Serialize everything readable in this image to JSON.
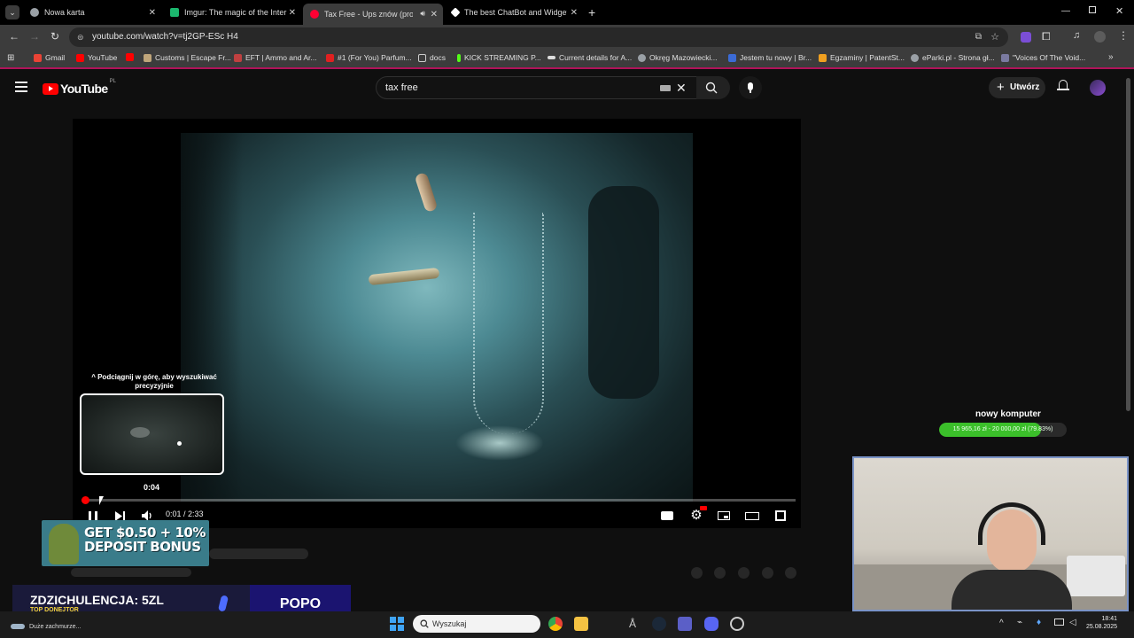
{
  "browser": {
    "tabs": [
      {
        "title": "Nowa karta",
        "favicon_color": "#9aa0a6"
      },
      {
        "title": "Imgur: The magic of the Interne",
        "favicon_color": "#1bb76e"
      },
      {
        "title": "Tax Free - Ups znów (prod.",
        "favicon_color": "#ff0033"
      },
      {
        "title": "The best ChatBot and Widgets",
        "favicon_color": "#ffffff"
      }
    ],
    "url": "youtube.com/watch?v=tj2GP-ESc H4",
    "bookmarks": [
      {
        "label": "Gmail",
        "color": "#ea4335"
      },
      {
        "label": "YouTube",
        "color": "#ff0000"
      },
      {
        "label": "Customs | Escape Fr...",
        "color": "#bfa57a"
      },
      {
        "label": "EFT | Ammo and Ar...",
        "color": "#c04040"
      },
      {
        "label": "#1 (For You) Parfum...",
        "color": "#e02020"
      },
      {
        "label": "docs",
        "color": "#9aa0a6"
      },
      {
        "label": "KICK STREAMING P...",
        "color": "#53fc18"
      },
      {
        "label": "Current details for A...",
        "color": "#dddddd"
      },
      {
        "label": "Okręg Mazowiecki...",
        "color": "#9aa0a6"
      },
      {
        "label": "Jestem tu nowy | Br...",
        "color": "#3b6bd6"
      },
      {
        "label": "Egzaminy | PatentSt...",
        "color": "#f0a020"
      },
      {
        "label": "eParki.pl - Strona gł...",
        "color": "#9aa0a6"
      },
      {
        "label": "\"Voices Of The Void...",
        "color": "#7a7aa0"
      }
    ]
  },
  "youtube": {
    "logo_text": "YouTube",
    "region": "PL",
    "search_value": "tax free",
    "create_label": "Utwórz"
  },
  "player": {
    "seek_hint": "Podciągnij w górę, aby wyszukiwać precyzyjnie",
    "preview_time": "0:04",
    "current_time": "0:01",
    "duration": "2:33",
    "time_display": "0:01 / 2:33",
    "progress_fraction": 0.0065
  },
  "overlay": {
    "goal_title": "nowy komputer",
    "goal_text": "15 965,16 zł - 20 000,00 zł (79.83%)",
    "goal_fraction": 0.7983,
    "goal_color": "#3bbf2a",
    "ad_text_line1": "GET $0.50 + 10%",
    "ad_text_line2": "DEPOSIT BONUS",
    "donor_name": "ZDZICHULENCJA: 5ZL",
    "donor_sub": "TOP DONEJTOR",
    "popo": "POPO"
  },
  "taskbar": {
    "search_placeholder": "Wyszukaj",
    "weather": "Duże zachmurze...",
    "time": "18:41",
    "date": "25.08.2025"
  }
}
